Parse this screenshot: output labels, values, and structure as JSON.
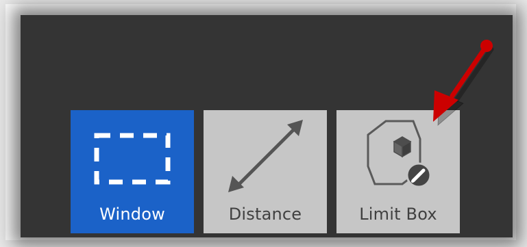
{
  "toolbar": {
    "buttons": [
      {
        "label": "Window",
        "icon": "dashed-rectangle-icon",
        "state": "selected"
      },
      {
        "label": "Distance",
        "icon": "double-arrow-diagonal-icon",
        "state": "normal"
      },
      {
        "label": "Limit Box",
        "icon": "limit-box-edit-icon",
        "state": "normal"
      }
    ]
  },
  "colors": {
    "panel_background": "#343434",
    "selected_button": "#1b62c8",
    "normal_button": "#c6c6c6",
    "annotation_arrow": "#cc0000"
  }
}
